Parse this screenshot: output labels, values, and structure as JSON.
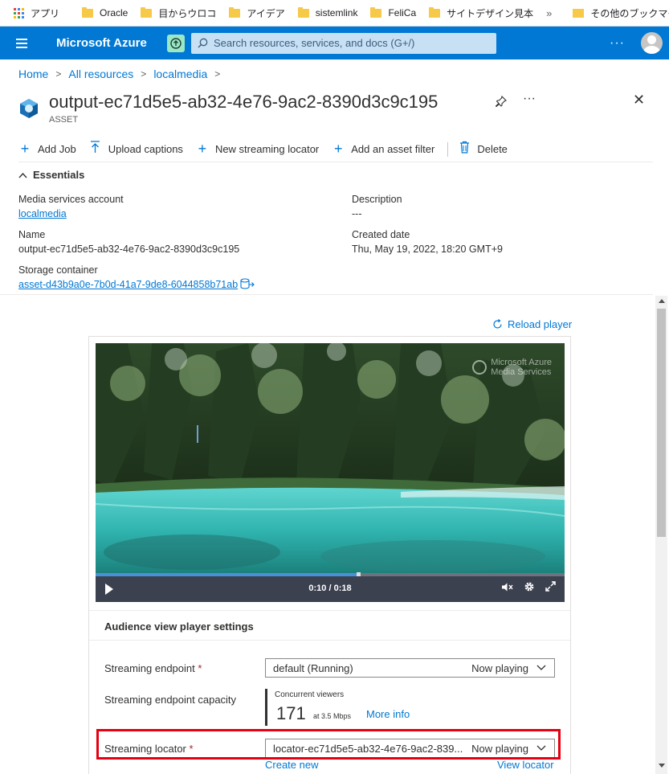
{
  "bookmarks": {
    "apps_label": "アプリ",
    "items": [
      "Oracle",
      "目からウロコ",
      "アイデア",
      "sistemlink",
      "FeliCa",
      "サイトデザイン見本"
    ],
    "more": "»",
    "other_label": "その他のブックマーク"
  },
  "header": {
    "brand": "Microsoft Azure",
    "search_placeholder": "Search resources, services, and docs (G+/)",
    "more": "···"
  },
  "breadcrumb": [
    "Home",
    "All resources",
    "localmedia"
  ],
  "page": {
    "title": "output-ec71d5e5-ab32-4e76-9ac2-8390d3c9c195",
    "subtitle": "ASSET",
    "more": "···",
    "close": "✕"
  },
  "commands": [
    {
      "label": "Add Job",
      "icon": "plus-icon"
    },
    {
      "label": "Upload captions",
      "icon": "upload-icon"
    },
    {
      "label": "New streaming locator",
      "icon": "plus-icon"
    },
    {
      "label": "Add an asset filter",
      "icon": "plus-icon"
    },
    {
      "label": "Delete",
      "icon": "trash-icon"
    }
  ],
  "essentials": {
    "header": "Essentials",
    "media_account_label": "Media services account",
    "media_account_value": "localmedia",
    "name_label": "Name",
    "name_value": "output-ec71d5e5-ab32-4e76-9ac2-8390d3c9c195",
    "storage_label": "Storage container",
    "storage_value": "asset-d43b9a0e-7b0d-41a7-9de8-6044858b71ab",
    "description_label": "Description",
    "description_value": "---",
    "created_label": "Created date",
    "created_value": "Thu, May 19, 2022, 18:20 GMT+9"
  },
  "player": {
    "reload": "Reload player",
    "watermark_line1": "Microsoft Azure",
    "watermark_line2": "Media Services",
    "time": "0:10 / 0:18",
    "progress": 0.56
  },
  "settings": {
    "title": "Audience view player settings",
    "endpoint_label": "Streaming endpoint",
    "required": "*",
    "endpoint_value": "default (Running)",
    "now_playing": "Now playing",
    "capacity_label": "Streaming endpoint capacity",
    "concurrent_label": "Concurrent viewers",
    "concurrent_value": "171",
    "rate": "at 3.5 Mbps",
    "more_info": "More info",
    "locator_label": "Streaming locator",
    "locator_value": "locator-ec71d5e5-ab32-4e76-9ac2-839...",
    "create_new": "Create new",
    "view_locator": "View locator"
  },
  "colors": {
    "azure_blue": "#0078d4",
    "highlight_red": "#e60012"
  }
}
